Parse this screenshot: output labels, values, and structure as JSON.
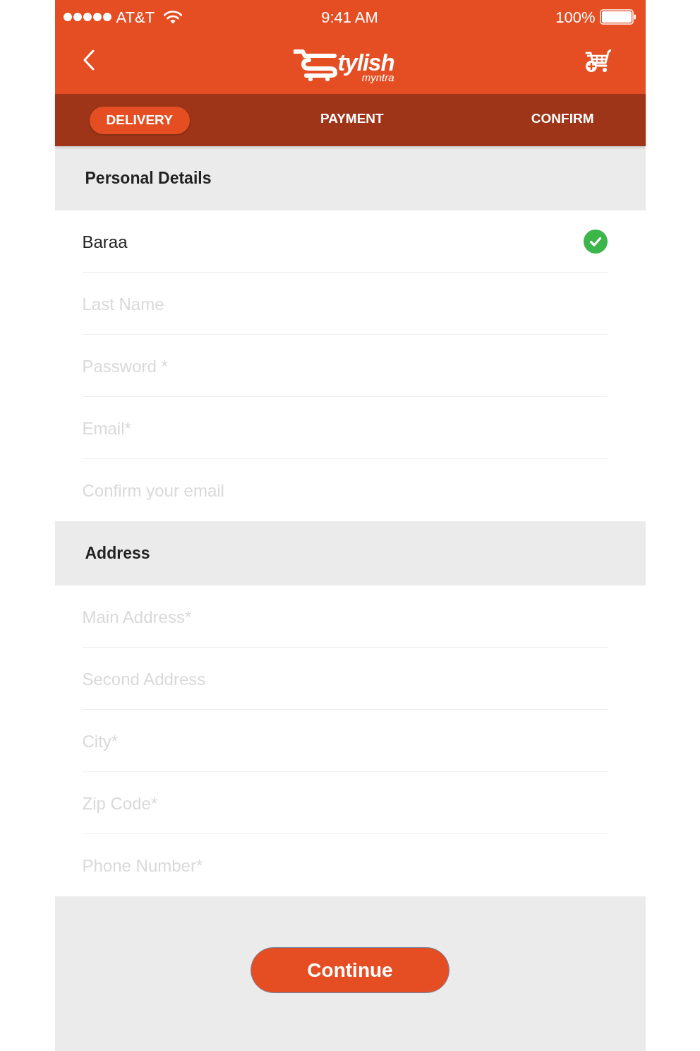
{
  "status_bar": {
    "carrier": "AT&T",
    "time": "9:41 AM",
    "battery": "100%"
  },
  "header": {
    "logo": {
      "wordmark": "tylish",
      "tagline": "myntra"
    }
  },
  "tabs": [
    {
      "label": "DELIVERY",
      "selected": true
    },
    {
      "label": "PAYMENT",
      "selected": false
    },
    {
      "label": "CONFIRM",
      "selected": false
    }
  ],
  "sections": [
    {
      "title": "Personal Details",
      "fields": [
        {
          "value": "Baraa",
          "valid": true
        },
        {
          "placeholder": "Last Name",
          "valid": false
        },
        {
          "placeholder": "Password *",
          "valid": false
        },
        {
          "placeholder": "Email*",
          "valid": false
        },
        {
          "placeholder": "Confirm your email",
          "valid": false
        }
      ]
    },
    {
      "title": "Address",
      "fields": [
        {
          "placeholder": "Main Address*",
          "valid": false
        },
        {
          "placeholder": "Second Address",
          "valid": false
        },
        {
          "placeholder": "City*",
          "valid": false
        },
        {
          "placeholder": "Zip Code*",
          "valid": false
        },
        {
          "placeholder": "Phone Number*",
          "valid": false
        }
      ]
    }
  ],
  "continue_button": {
    "label": "Continue"
  }
}
